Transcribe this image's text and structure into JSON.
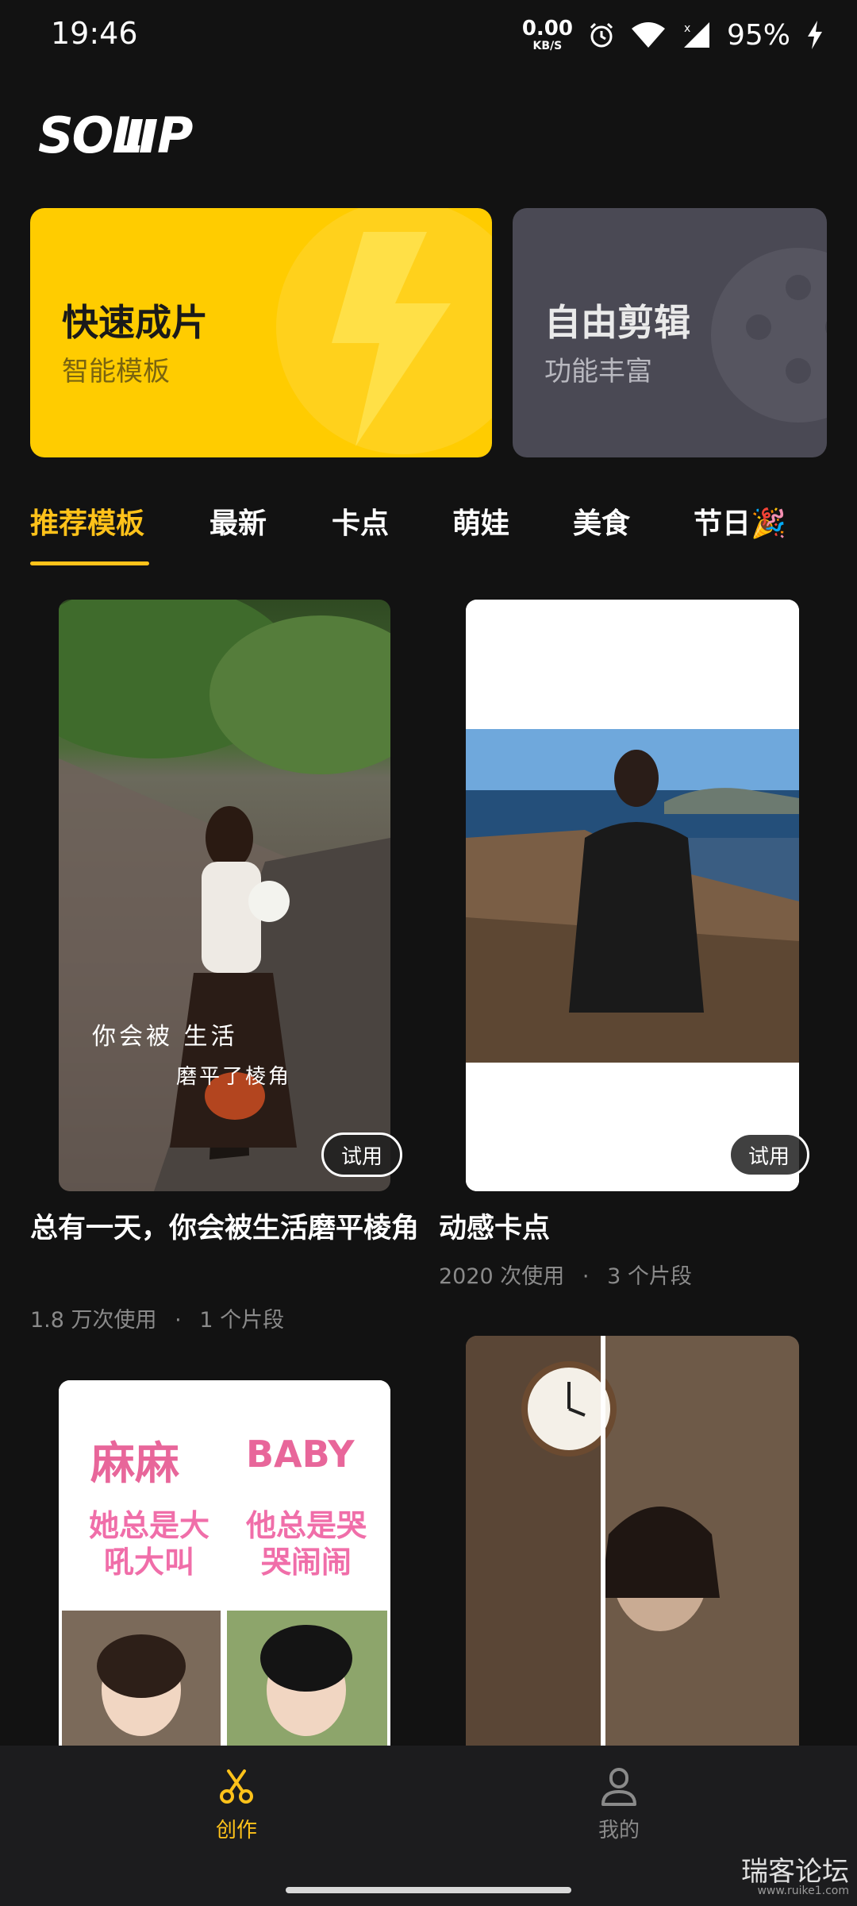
{
  "status_bar": {
    "time": "19:46",
    "net_speed_value": "0.00",
    "net_speed_unit": "KB/S",
    "battery": "95%"
  },
  "app": {
    "logo_text": "SOLIIP"
  },
  "feature_cards": [
    {
      "title": "快速成片",
      "subtitle": "智能模板",
      "color": "#FFCC00"
    },
    {
      "title": "自由剪辑",
      "subtitle": "功能丰富",
      "color": "#4A4954"
    }
  ],
  "tabs": [
    {
      "label": "推荐模板",
      "active": true
    },
    {
      "label": "最新",
      "active": false
    },
    {
      "label": "卡点",
      "active": false
    },
    {
      "label": "萌娃",
      "active": false
    },
    {
      "label": "美食",
      "active": false
    },
    {
      "label": "节日🎉",
      "active": false
    }
  ],
  "templates": [
    {
      "title": "总有一天，你会被生活磨平棱角",
      "usage": "1.8 万次使用",
      "clips": "1 个片段",
      "badge": "试用",
      "overlay_line1": "你会被 生活",
      "overlay_line2": "磨平了棱角"
    },
    {
      "title": "动感卡点",
      "usage": "2020 次使用",
      "clips": "3 个片段",
      "badge": "试用"
    },
    {
      "overlay_left_top": "麻麻",
      "overlay_left_bottom": "她总是大吼大叫",
      "overlay_right_top": "BABY",
      "overlay_right_bottom": "他总是哭哭闹闹"
    },
    {}
  ],
  "meta_separator": "·",
  "bottom_nav": [
    {
      "label": "创作",
      "icon": "scissors-icon",
      "active": true
    },
    {
      "label": "我的",
      "icon": "user-icon",
      "active": false
    }
  ],
  "watermark": {
    "text": "瑞客论坛",
    "url": "www.ruike1.com"
  },
  "colors": {
    "accent": "#FFC21A",
    "background": "#121212",
    "quick_card": "#FFCC00",
    "free_card": "#4A4954"
  }
}
